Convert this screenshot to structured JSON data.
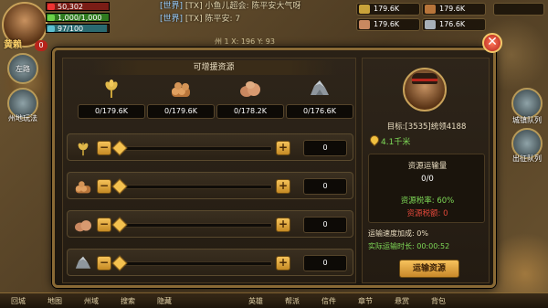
{
  "hud": {
    "player_name": "黄赖",
    "player_level": "0",
    "stats": [
      "50,302",
      "1,000/1,000",
      "97/100"
    ],
    "top_resources": [
      "179.6K",
      "179.6K",
      "179.6K",
      "176.6K"
    ],
    "coord": "州  1   X: 196  Y: 93"
  },
  "chat": [
    {
      "channel": "[世界]",
      "text": "[TX] 小鱼儿超会: 陈平安大气呀"
    },
    {
      "channel": "[世界]",
      "text": "[TX] 陈平安: 7"
    }
  ],
  "side_labels": [
    "左路",
    "州地玩法",
    "城镇队列",
    "出征队列"
  ],
  "bottom_nav": [
    "回城",
    "地图",
    "州域",
    "搜索",
    "隐藏",
    "英雄",
    "帮派",
    "信件",
    "章节",
    "悬赏",
    "背包"
  ],
  "panel": {
    "title": "可增援资源",
    "close_label": "✕",
    "resources": [
      {
        "name": "wheat",
        "current": "0",
        "max": "179.6K",
        "amount": "0",
        "icon": "wheat-icon"
      },
      {
        "name": "wood",
        "current": "0",
        "max": "179.6K",
        "amount": "0",
        "icon": "wood-icon"
      },
      {
        "name": "stone",
        "current": "0",
        "max": "178.2K",
        "amount": "0",
        "icon": "stone-icon"
      },
      {
        "name": "iron",
        "current": "0",
        "max": "176.6K",
        "amount": "0",
        "icon": "iron-icon"
      }
    ],
    "col_labels": [
      "0/179.6K",
      "0/179.6K",
      "0/178.2K",
      "0/176.6K"
    ],
    "slider_min": "−",
    "slider_plus": "+",
    "target_label": "目标:[3535]统领4188",
    "distance": "4.1千米",
    "transport_amount_label": "资源运输量",
    "transport_amount": "0/0",
    "tax_rate": "资源税率: 60%",
    "tax_amount": "资源税额: 0",
    "speed_bonus": "运输速度加成: 0%",
    "duration": "实际运输时长: 00:00:52",
    "transport_button": "运输资源"
  },
  "colors": {
    "gold": "#f4c14f",
    "green": "#7ed957",
    "red": "#e0473a",
    "panel": "#2a2116",
    "border": "#8a6a35"
  }
}
